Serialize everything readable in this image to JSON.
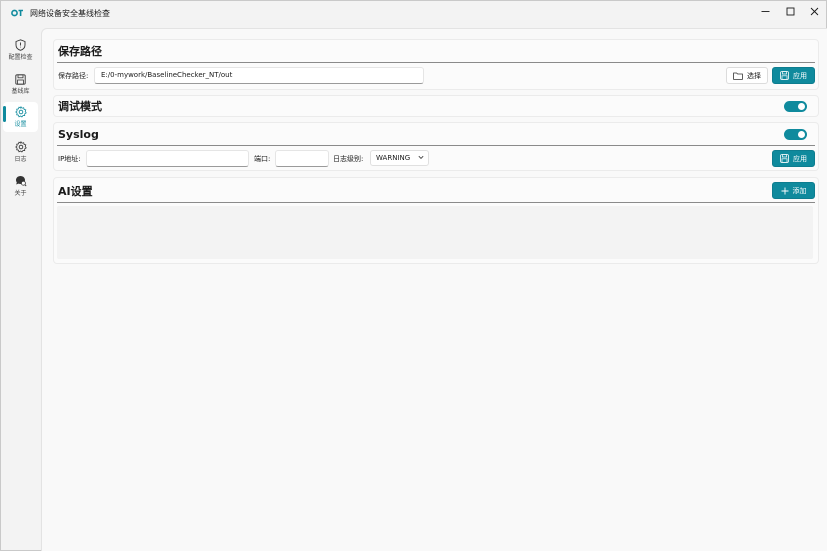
{
  "app": {
    "logo_text": "OT",
    "title": "网络设备安全基线检查",
    "accent_color": "#0f8a9d"
  },
  "window_controls": {
    "minimize_icon": "minimize-icon",
    "maximize_icon": "maximize-icon",
    "close_icon": "close-icon"
  },
  "sidebar": {
    "items": [
      {
        "label": "配置检查",
        "icon": "shield-icon"
      },
      {
        "label": "基线库",
        "icon": "save-icon"
      },
      {
        "label": "设置",
        "icon": "gear-icon",
        "active": true
      },
      {
        "label": "日志",
        "icon": "gear-icon"
      },
      {
        "label": "关于",
        "icon": "chat-search-icon"
      }
    ]
  },
  "save_path": {
    "title": "保存路径",
    "field_label": "保存路径:",
    "value": "E:/0-mywork/BaselineChecker_NT/out",
    "select_label": "选择",
    "apply_label": "应用"
  },
  "debug_mode": {
    "title": "调试模式",
    "enabled": true
  },
  "syslog": {
    "title": "Syslog",
    "enabled": true,
    "ip_label": "IP地址:",
    "ip_value": "",
    "port_label": "端口:",
    "port_value": "",
    "level_label": "日志级别:",
    "level_value": "WARNING",
    "apply_label": "应用"
  },
  "ai_settings": {
    "title": "AI设置",
    "add_label": "添加"
  }
}
